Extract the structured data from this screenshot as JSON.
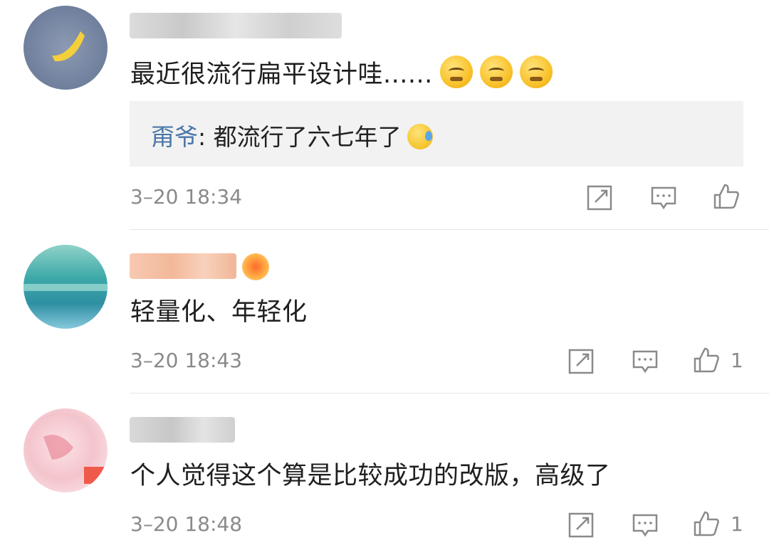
{
  "comments": [
    {
      "text": "最近很流行扁平设计哇......",
      "emoji_names": [
        "thinking-face-emoji",
        "thinking-face-emoji",
        "thinking-face-emoji"
      ],
      "reply": {
        "name": "甭爷",
        "separator": ": ",
        "text": "都流行了六七年了",
        "emoji": "sweat-face-emoji"
      },
      "time": "3–20 18:34",
      "likes": ""
    },
    {
      "text": "轻量化、年轻化",
      "time": "3–20 18:43",
      "likes": "1"
    },
    {
      "text": "个人觉得这个算是比较成功的改版，高级了",
      "time": "3–20 18:48",
      "likes": "1"
    }
  ],
  "icons": {
    "share": "share-icon",
    "comment": "comment-icon",
    "like": "thumbs-up-icon"
  },
  "colors": {
    "reply_name": "#4b77a8",
    "reply_bg": "#f2f2f2",
    "meta": "#8a8a8a"
  }
}
